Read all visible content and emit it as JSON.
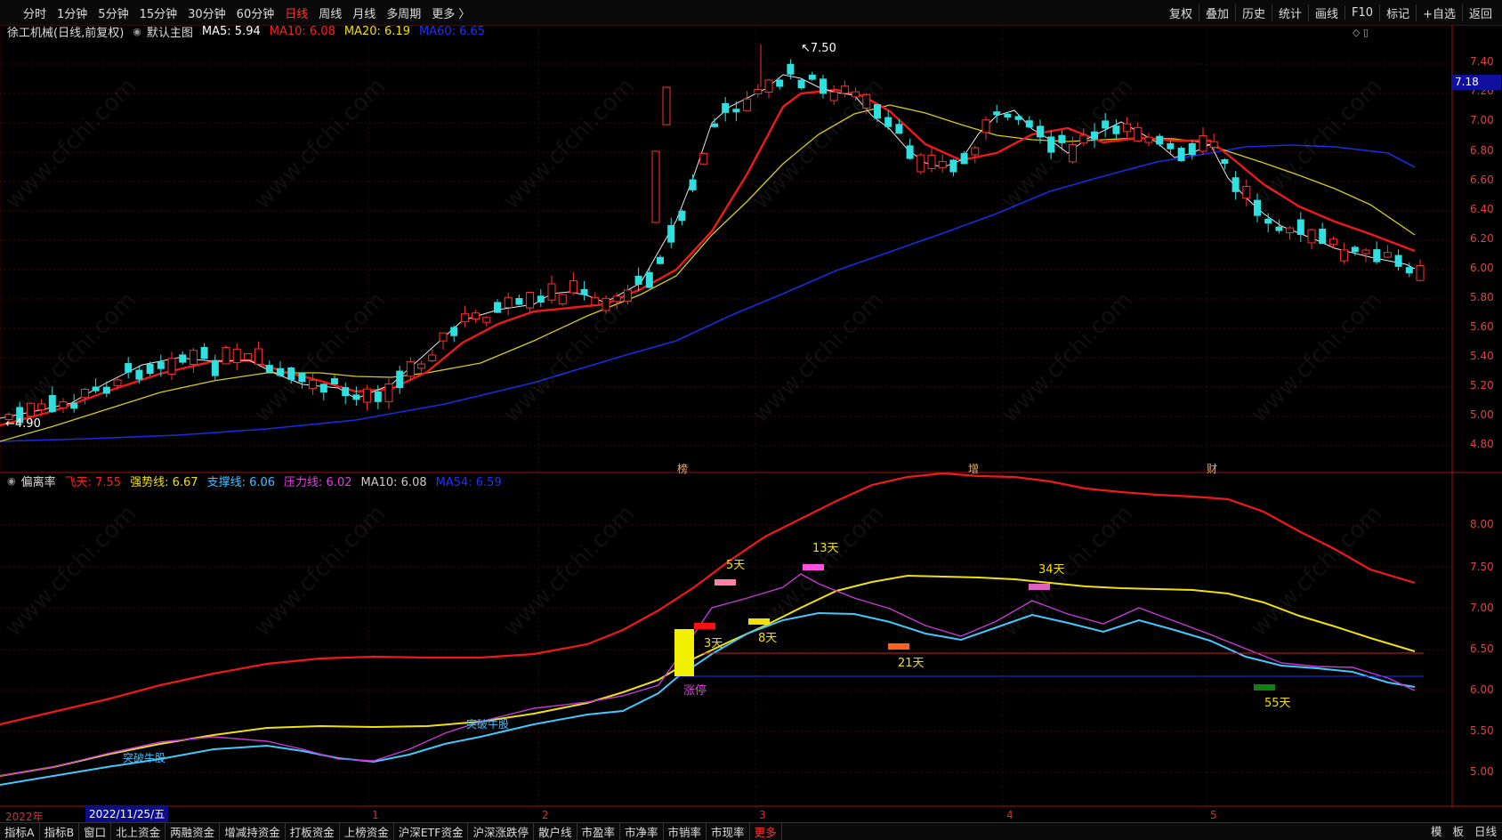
{
  "toolbar": {
    "periods": [
      {
        "label": "分时"
      },
      {
        "label": "1分钟"
      },
      {
        "label": "5分钟"
      },
      {
        "label": "15分钟"
      },
      {
        "label": "30分钟"
      },
      {
        "label": "60分钟"
      },
      {
        "label": "日线",
        "active": true
      },
      {
        "label": "周线"
      },
      {
        "label": "月线"
      },
      {
        "label": "多周期"
      },
      {
        "label": "更多 〉"
      }
    ],
    "tools": [
      "复权",
      "叠加",
      "历史",
      "统计",
      "画线",
      "F10",
      "标记",
      "+自选",
      "返回"
    ]
  },
  "main_chart": {
    "title": "徐工机械(日线,前复权)",
    "indicator_name": "默认主图",
    "legend": [
      {
        "label": "MA5: 5.94",
        "color": "#ffffff"
      },
      {
        "label": "MA10: 6.08",
        "color": "#ff2020"
      },
      {
        "label": "MA20: 6.19",
        "color": "#f0e000"
      },
      {
        "label": "MA60: 6.65",
        "color": "#2030ff"
      }
    ],
    "y_ticks": [
      "7.40",
      "7.20",
      "7.00",
      "6.80",
      "6.60",
      "6.40",
      "6.20",
      "6.00",
      "5.80",
      "5.60",
      "5.40",
      "5.20",
      "5.00",
      "4.80"
    ],
    "current_price": "7.18",
    "high_label": "7.50",
    "low_label": "4.90",
    "event_markers": [
      "榜",
      "增",
      "财"
    ]
  },
  "sub_chart": {
    "title": "偏离率",
    "legend": [
      {
        "label": "飞天: 7.55",
        "color": "#ff2020"
      },
      {
        "label": "强势线: 6.67",
        "color": "#f0e000"
      },
      {
        "label": "支撑线: 6.06",
        "color": "#40c0ff"
      },
      {
        "label": "压力线: 6.02",
        "color": "#e040e0"
      },
      {
        "label": "MA10: 6.08",
        "color": "#cccccc"
      },
      {
        "label": "MA54: 6.59",
        "color": "#2030ff"
      }
    ],
    "y_ticks": [
      "8.00",
      "7.50",
      "7.00",
      "6.50",
      "6.00",
      "5.50",
      "5.00"
    ],
    "annotations": [
      {
        "label": "5天",
        "color": "#f0e000"
      },
      {
        "label": "13天",
        "color": "#f0e000"
      },
      {
        "label": "34天",
        "color": "#f0e000"
      },
      {
        "label": "3天",
        "color": "#f0e000"
      },
      {
        "label": "8天",
        "color": "#f0e000"
      },
      {
        "label": "21天",
        "color": "#f0e000"
      },
      {
        "label": "55天",
        "color": "#f0e000"
      },
      {
        "label": "涨停",
        "color": "#e040e0"
      },
      {
        "label": "突破牛股",
        "color": "#40c0ff"
      },
      {
        "label": "突破牛股",
        "color": "#40c0ff"
      }
    ]
  },
  "x_axis": {
    "labels": [
      "2022年",
      "1",
      "2",
      "3",
      "4",
      "5"
    ],
    "cursor_date": "2022/11/25/五"
  },
  "bottom_tabs": [
    "指标A",
    "指标B",
    "窗口",
    "北上资金",
    "两融资金",
    "增减持资金",
    "打板资金",
    "上榜资金",
    "沪深ETF资金",
    "沪深涨跌停",
    "散户线",
    "市盈率",
    "市净率",
    "市销率",
    "市现率",
    "更多"
  ],
  "bottom_right": [
    "模",
    "板",
    "日线"
  ],
  "watermark": "www.cfchi.com"
}
